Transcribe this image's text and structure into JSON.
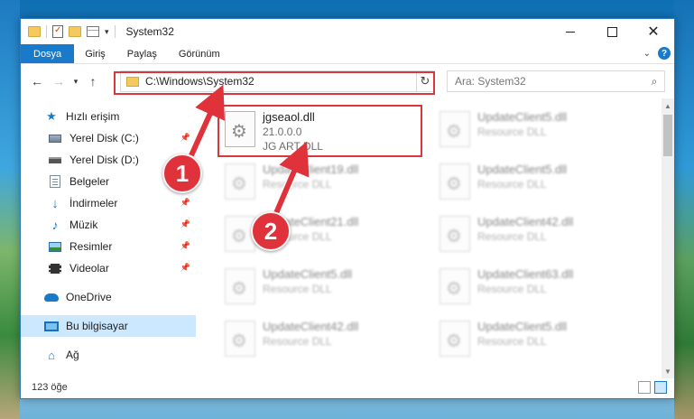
{
  "window": {
    "title": "System32"
  },
  "ribbon": {
    "tabs": [
      "Dosya",
      "Giriş",
      "Paylaş",
      "Görünüm"
    ]
  },
  "address": {
    "path": "C:\\Windows\\System32"
  },
  "search": {
    "placeholder": "Ara: System32"
  },
  "sidebar": {
    "items": [
      {
        "label": "Hızlı erişim",
        "icon": "star-icon"
      },
      {
        "label": "Yerel Disk (C:)",
        "icon": "disk-icon",
        "pinned": true
      },
      {
        "label": "Yerel Disk (D:)",
        "icon": "disk-icon",
        "pinned": true
      },
      {
        "label": "Belgeler",
        "icon": "documents-icon",
        "pinned": true
      },
      {
        "label": "İndirmeler",
        "icon": "downloads-icon",
        "pinned": true
      },
      {
        "label": "Müzik",
        "icon": "music-icon",
        "pinned": true
      },
      {
        "label": "Resimler",
        "icon": "pictures-icon",
        "pinned": true
      },
      {
        "label": "Videolar",
        "icon": "videos-icon",
        "pinned": true
      },
      {
        "label": "OneDrive",
        "icon": "onedrive-icon"
      },
      {
        "label": "Bu bilgisayar",
        "icon": "computer-icon"
      },
      {
        "label": "Ağ",
        "icon": "network-icon"
      }
    ]
  },
  "files": [
    {
      "name": "jgseaol.dll",
      "version": "21.0.0.0",
      "desc": "JG ART DLL"
    },
    {
      "name": "UpdateClient5.dll",
      "desc": "Resource DLL"
    },
    {
      "name": "UpdateClient19.dll",
      "desc": "Resource DLL"
    },
    {
      "name": "UpdateClient5.dll",
      "desc": "Resource DLL"
    },
    {
      "name": "UpdateClient21.dll",
      "desc": "Resource DLL"
    },
    {
      "name": "UpdateClient42.dll",
      "desc": "Resource DLL"
    },
    {
      "name": "UpdateClient5.dll",
      "desc": "Resource DLL"
    },
    {
      "name": "UpdateClient63.dll",
      "desc": "Resource DLL"
    },
    {
      "name": "UpdateClient42.dll",
      "desc": "Resource DLL"
    },
    {
      "name": "UpdateClient5.dll",
      "desc": "Resource DLL"
    }
  ],
  "status": {
    "count": "123 öğe"
  },
  "annotations": {
    "badge1": "1",
    "badge2": "2",
    "color": "#e0323b"
  }
}
